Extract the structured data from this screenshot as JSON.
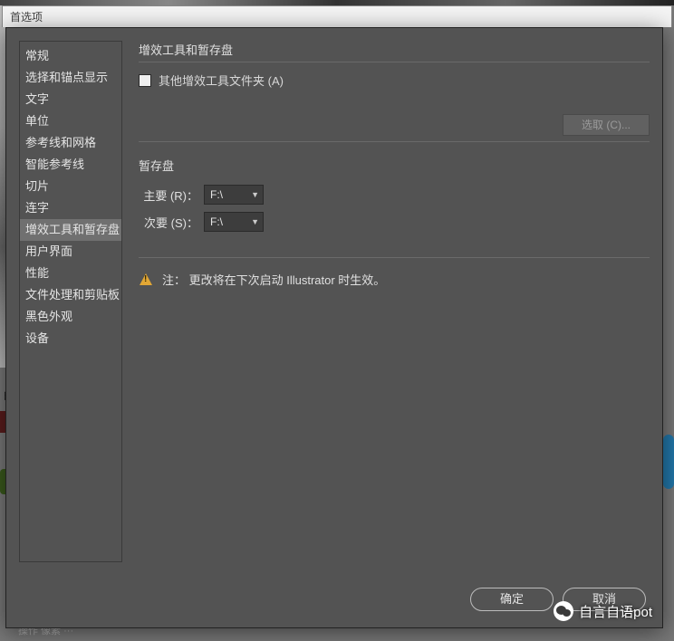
{
  "window": {
    "title": "首选项"
  },
  "sidebar": {
    "items": [
      {
        "label": "常规"
      },
      {
        "label": "选择和锚点显示"
      },
      {
        "label": "文字"
      },
      {
        "label": "单位"
      },
      {
        "label": "参考线和网格"
      },
      {
        "label": "智能参考线"
      },
      {
        "label": "切片"
      },
      {
        "label": "连字"
      },
      {
        "label": "增效工具和暂存盘",
        "selected": true
      },
      {
        "label": "用户界面"
      },
      {
        "label": "性能"
      },
      {
        "label": "文件处理和剪贴板"
      },
      {
        "label": "黑色外观"
      },
      {
        "label": "设备"
      }
    ]
  },
  "main": {
    "section1_title": "增效工具和暂存盘",
    "checkbox_label": "其他增效工具文件夹 (A)",
    "select_button": "选取 (C)...",
    "section2_title": "暂存盘",
    "primary_label": "主要 (R)：",
    "primary_value": "F:\\",
    "secondary_label": "次要 (S)：",
    "secondary_value": "F:\\",
    "note_text": "注： 更改将在下次启动 Illustrator 时生效。"
  },
  "footer": {
    "ok": "确定",
    "cancel": "取消"
  },
  "overlay": {
    "hint": "自言自语pot"
  },
  "bg": {
    "left_text": "的",
    "bottom_text": "操作           像素   ···"
  }
}
